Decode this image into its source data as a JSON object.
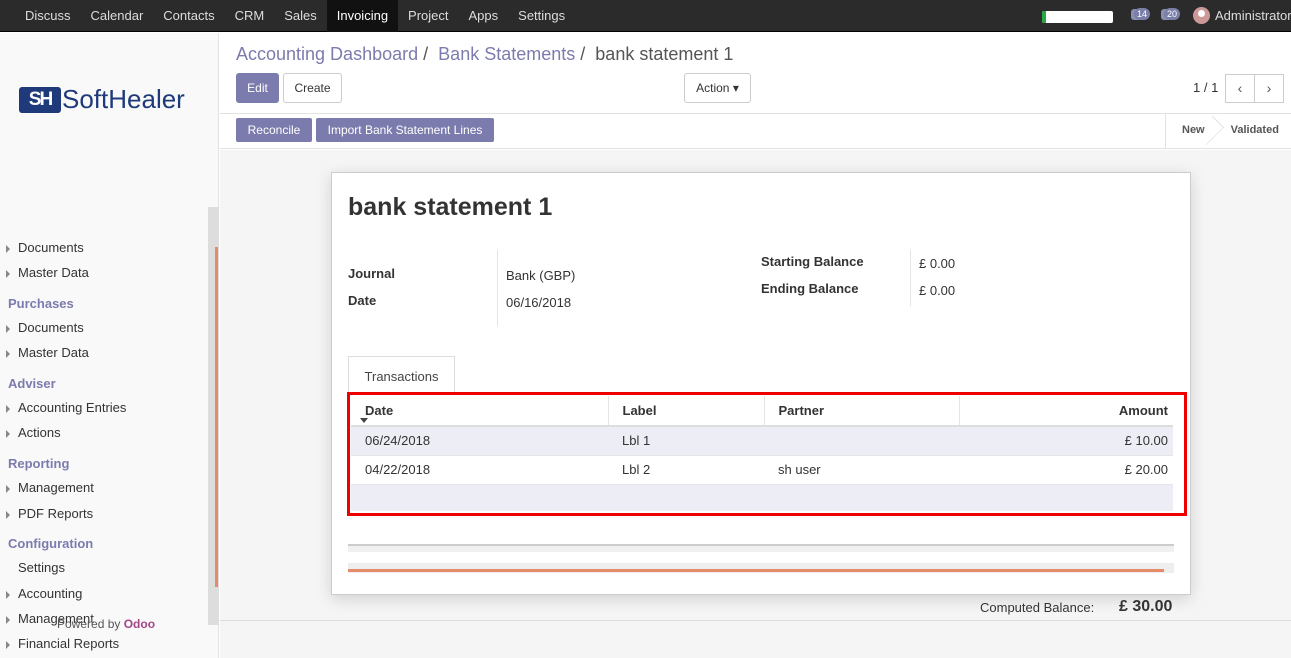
{
  "topbar": {
    "menu": [
      "Discuss",
      "Calendar",
      "Contacts",
      "CRM",
      "Sales",
      "Invoicing",
      "Project",
      "Apps",
      "Settings"
    ],
    "active": "Invoicing",
    "progress_fraction": 0.06,
    "notifications": {
      "activity_count": "14",
      "messages_count": "20"
    },
    "user_name": "Administrator"
  },
  "sidebar": {
    "logo_mark": "SH",
    "logo_text": "SoftHealer",
    "sections": [
      {
        "items": [
          "Documents",
          "Master Data"
        ]
      },
      {
        "heading": "Purchases",
        "items": [
          "Documents",
          "Master Data"
        ]
      },
      {
        "heading": "Adviser",
        "items": [
          "Accounting Entries",
          "Actions"
        ]
      },
      {
        "heading": "Reporting",
        "items": [
          "Management",
          "PDF Reports"
        ]
      },
      {
        "heading": "Configuration",
        "items": [
          "Settings",
          "Accounting",
          "Management",
          "Financial Reports"
        ]
      }
    ],
    "powered_prefix": "Powered by",
    "powered_brand": "Odoo"
  },
  "breadcrumb": {
    "item1": "Accounting Dashboard",
    "item2": "Bank Statements",
    "current": "bank statement 1",
    "sep": "/"
  },
  "buttons": {
    "edit": "Edit",
    "create": "Create",
    "action": "Action",
    "reconcile": "Reconcile",
    "import": "Import Bank Statement Lines"
  },
  "pager": {
    "value": "1 / 1",
    "prev": "‹",
    "next": "›"
  },
  "states": {
    "new": "New",
    "validated": "Validated"
  },
  "form": {
    "title": "bank statement 1",
    "journal_label": "Journal",
    "journal_value": "Bank (GBP)",
    "date_label": "Date",
    "date_value": "06/16/2018",
    "start_label": "Starting Balance",
    "start_value": "£ 0.00",
    "end_label": "Ending Balance",
    "end_value": "£ 0.00"
  },
  "tab": "Transactions",
  "table": {
    "headers": [
      "Date",
      "Label",
      "Partner",
      "Amount"
    ],
    "rows": [
      {
        "date": "06/24/2018",
        "label": "Lbl 1",
        "partner": "",
        "amount": "£ 10.00"
      },
      {
        "date": "04/22/2018",
        "label": "Lbl 2",
        "partner": "sh user",
        "amount": "£ 20.00"
      }
    ]
  },
  "computed": {
    "label": "Computed Balance:",
    "value": "£ 30.00"
  },
  "colors": {
    "brand": "#7c7bad",
    "highlight": "#ee0000",
    "accent": "#e58b6a"
  }
}
